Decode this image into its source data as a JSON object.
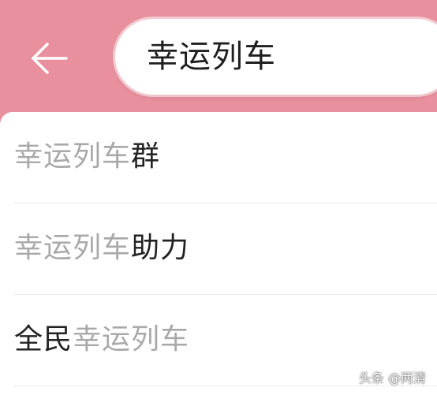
{
  "search": {
    "query": "幸运列车"
  },
  "suggestions": [
    {
      "pre": "",
      "highlight": "幸运列车",
      "post": "群"
    },
    {
      "pre": "",
      "highlight": "幸运列车",
      "post": "助力"
    },
    {
      "pre": "全民",
      "highlight": "幸运列车",
      "post": ""
    }
  ],
  "watermark": "头条 @两清",
  "colors": {
    "header_bg": "#e8909e",
    "highlight_text": "#a9a9a9",
    "normal_text": "#222222"
  },
  "icons": {
    "back": "arrow-left-icon"
  }
}
